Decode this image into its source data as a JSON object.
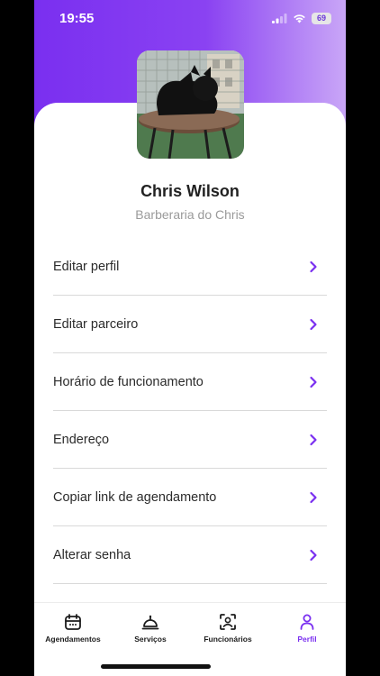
{
  "status_bar": {
    "time": "19:55",
    "battery": "69"
  },
  "profile": {
    "name": "Chris Wilson",
    "business": "Barberaria do Chris"
  },
  "menu": {
    "items": [
      {
        "label": "Editar perfil"
      },
      {
        "label": "Editar parceiro"
      },
      {
        "label": "Horário de funcionamento"
      },
      {
        "label": "Endereço"
      },
      {
        "label": "Copiar link de agendamento"
      },
      {
        "label": "Alterar senha"
      }
    ]
  },
  "tabbar": {
    "tabs": [
      {
        "label": "Agendamentos",
        "icon": "calendar-icon"
      },
      {
        "label": "Serviços",
        "icon": "service-bell-icon"
      },
      {
        "label": "Funcionários",
        "icon": "face-scan-icon"
      },
      {
        "label": "Perfil",
        "icon": "user-icon",
        "active": true
      }
    ]
  },
  "colors": {
    "accent": "#7a2ff0",
    "text": "#2b2b2b",
    "muted": "#9a9a9a"
  }
}
